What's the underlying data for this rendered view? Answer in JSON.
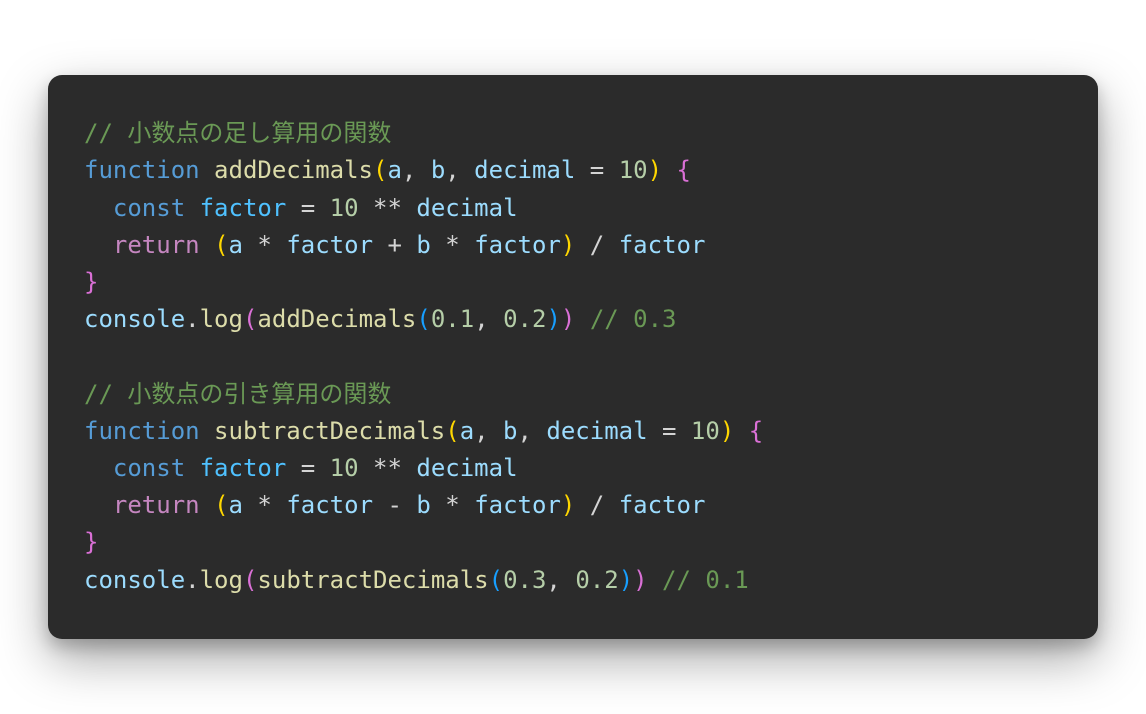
{
  "code": {
    "line1": {
      "comment": "// 小数点の足し算用の関数"
    },
    "line2": {
      "kw_function": "function",
      "fn_name": "addDecimals",
      "p1": "a",
      "c1": ", ",
      "p2": "b",
      "c2": ", ",
      "p3": "decimal",
      "eq": " = ",
      "num": "10",
      "brace": " {"
    },
    "line3": {
      "indent": "  ",
      "kw_const": "const",
      "sp1": " ",
      "var": "factor",
      "eq": " = ",
      "n1": "10",
      "op": " ** ",
      "v2": "decimal"
    },
    "line4": {
      "indent": "  ",
      "kw_return": "return",
      "sp": " ",
      "lp": "(",
      "a": "a",
      "op1": " * ",
      "f1": "factor",
      "plus": " + ",
      "b": "b",
      "op2": " * ",
      "f2": "factor",
      "rp": ")",
      "div": " / ",
      "f3": "factor"
    },
    "line5": {
      "brace": "}"
    },
    "line6": {
      "obj": "console",
      "dot": ".",
      "method": "log",
      "lp1": "(",
      "fn": "addDecimals",
      "lp2": "(",
      "n1": "0.1",
      "c": ", ",
      "n2": "0.2",
      "rp2": ")",
      "rp1": ")",
      "sp": " ",
      "comment": "// 0.3"
    },
    "line7": {
      "blank": ""
    },
    "line8": {
      "comment": "// 小数点の引き算用の関数"
    },
    "line9": {
      "kw_function": "function",
      "fn_name": "subtractDecimals",
      "p1": "a",
      "c1": ", ",
      "p2": "b",
      "c2": ", ",
      "p3": "decimal",
      "eq": " = ",
      "num": "10",
      "brace": " {"
    },
    "line10": {
      "indent": "  ",
      "kw_const": "const",
      "sp1": " ",
      "var": "factor",
      "eq": " = ",
      "n1": "10",
      "op": " ** ",
      "v2": "decimal"
    },
    "line11": {
      "indent": "  ",
      "kw_return": "return",
      "sp": " ",
      "lp": "(",
      "a": "a",
      "op1": " * ",
      "f1": "factor",
      "minus": " - ",
      "b": "b",
      "op2": " * ",
      "f2": "factor",
      "rp": ")",
      "div": " / ",
      "f3": "factor"
    },
    "line12": {
      "brace": "}"
    },
    "line13": {
      "obj": "console",
      "dot": ".",
      "method": "log",
      "lp1": "(",
      "fn": "subtractDecimals",
      "lp2": "(",
      "n1": "0.3",
      "c": ", ",
      "n2": "0.2",
      "rp2": ")",
      "rp1": ")",
      "sp": " ",
      "comment": "// 0.1"
    }
  }
}
